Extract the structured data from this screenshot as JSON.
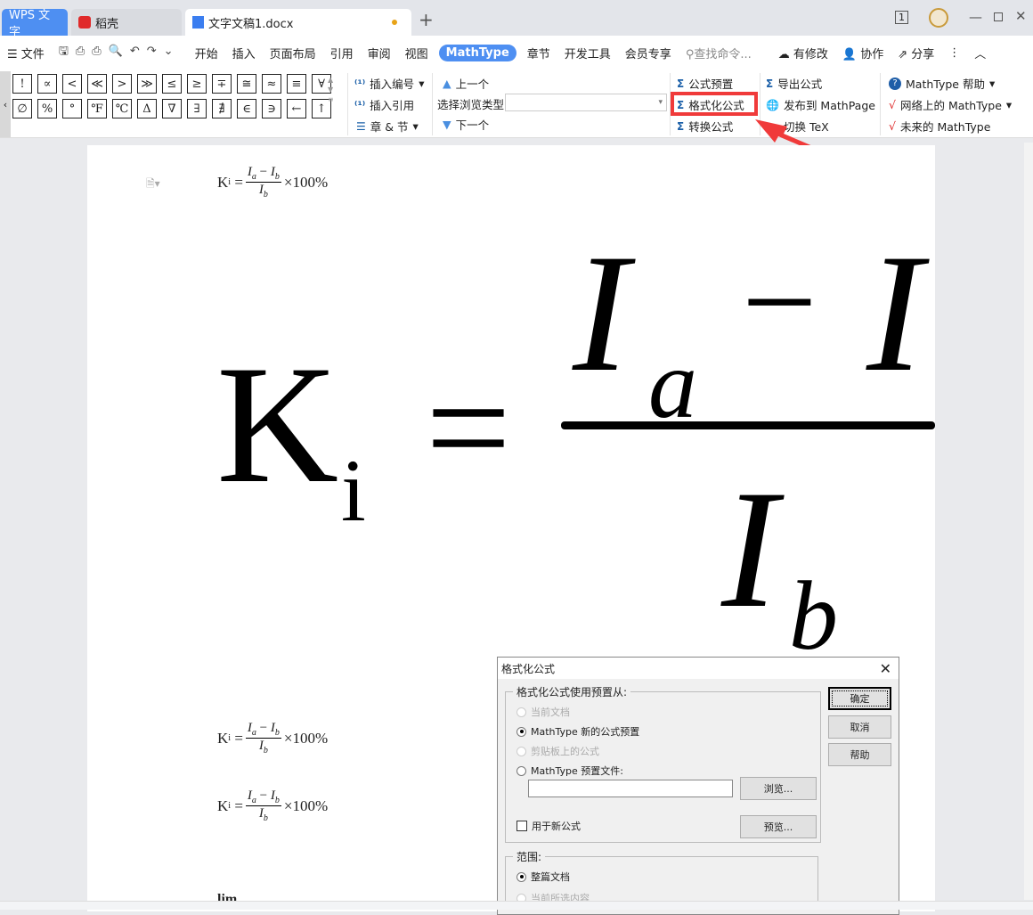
{
  "tabs": [
    {
      "label": "WPS 文字"
    },
    {
      "label": "稻壳"
    },
    {
      "label": "文字文稿1.docx"
    }
  ],
  "toolbar": {
    "file": "文件",
    "menus": [
      "开始",
      "插入",
      "页面布局",
      "引用",
      "审阅",
      "视图",
      "MathType",
      "章节",
      "开发工具",
      "会员专享"
    ],
    "search": "查找命令...",
    "modified": "有修改",
    "collab": "协作",
    "share": "分享"
  },
  "symbols": {
    "row1": [
      "!",
      "∝",
      "<",
      "≪",
      ">",
      "≫",
      "≤",
      "≥",
      "∓",
      "≅",
      "≈",
      "≡",
      "∀"
    ],
    "row2": [
      "∅",
      "%",
      "°",
      "℉",
      "℃",
      "Δ",
      "∇",
      "∃",
      "∄",
      "∈",
      "∋",
      "←",
      "↑"
    ]
  },
  "ribbon": {
    "insert_number": "插入编号",
    "insert_ref": "插入引用",
    "chapter": "章 & 节",
    "prev": "上一个",
    "browse_type": "选择浏览类型",
    "next": "下一个",
    "presets": "公式预置",
    "format": "格式化公式",
    "convert": "转换公式",
    "export": "导出公式",
    "publish": "发布到 MathPage",
    "tex": "切换 TeX",
    "help": "MathType 帮助",
    "online": "网络上的 MathType",
    "future": "未来的 MathType"
  },
  "document": {
    "formula": {
      "lhs": "K",
      "lhs_sub": "i",
      "num_a": "I",
      "sub_a": "a",
      "minus": "−",
      "num_b": "I",
      "sub_b": "b",
      "den": "I",
      "den_sub": "b",
      "tail": "×100%",
      "eq": "="
    },
    "lim": "lim"
  },
  "dialog": {
    "title": "格式化公式",
    "group1": "格式化公式使用预置从:",
    "opt_current": "当前文档",
    "opt_new": "MathType 新的公式预置",
    "opt_clip": "剪贴板上的公式",
    "opt_file": "MathType 预置文件:",
    "file_value": "",
    "browse": "浏览...",
    "use_new": "用于新公式",
    "preview": "预览...",
    "group2": "范围:",
    "scope_all": "整篇文档",
    "scope_sel": "当前所选内容",
    "ok": "确定",
    "cancel": "取消",
    "help": "帮助"
  },
  "colors": {
    "accent": "#4e8ff2",
    "highlight": "#f03a3a"
  }
}
